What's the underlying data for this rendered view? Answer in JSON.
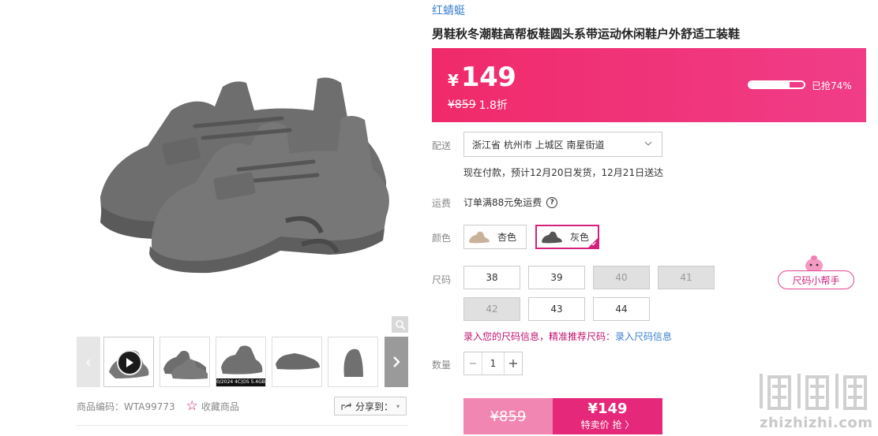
{
  "product": {
    "brand": "红蜻蜓",
    "title": "男鞋秋冬潮鞋高帮板鞋圆头系带运动休闲鞋户外舒适工装鞋"
  },
  "price": {
    "currency": "¥",
    "current": "149",
    "original": "¥859",
    "discount": "1.8折",
    "sold_progress_text": "已抢74%",
    "sold_progress_fraction": 0.74
  },
  "delivery": {
    "label": "配送",
    "address": "浙江省 杭州市 上城区 南星街道",
    "note": "现在付款，预计12月20日发货，12月21日送达"
  },
  "freight": {
    "label": "运费",
    "text": "订单满88元免运费",
    "help_icon": "?"
  },
  "colors": {
    "label": "颜色",
    "options": [
      {
        "name": "杏色",
        "selected": false
      },
      {
        "name": "灰色",
        "selected": true
      }
    ]
  },
  "sizes": {
    "label": "尺码",
    "options": [
      {
        "value": "38",
        "available": true
      },
      {
        "value": "39",
        "available": true
      },
      {
        "value": "40",
        "available": false
      },
      {
        "value": "41",
        "available": false
      },
      {
        "value": "42",
        "available": false
      },
      {
        "value": "43",
        "available": true
      },
      {
        "value": "44",
        "available": true
      }
    ],
    "helper_button": "尺码小帮手",
    "tip_pink": "录入您的尺码信息，精准推荐尺码：",
    "tip_link": "录入尺码信息"
  },
  "quantity": {
    "label": "数量",
    "value": "1"
  },
  "buy": {
    "original_price": "¥859",
    "special_price": "¥149",
    "special_label": "特卖价 抢 〉"
  },
  "gallery": {
    "thumb_caption": "0/2024 4C|OS 5.4GB",
    "sku_text": "商品编码：WTA99773",
    "favorite_label": "收藏商品",
    "share_label": "分享到："
  },
  "watermark": {
    "text": "zhizhizhi.com"
  },
  "colors_theme": {
    "accent": "#f02a6a",
    "accent_dark": "#d4217d",
    "link_blue": "#3b7fd0"
  }
}
